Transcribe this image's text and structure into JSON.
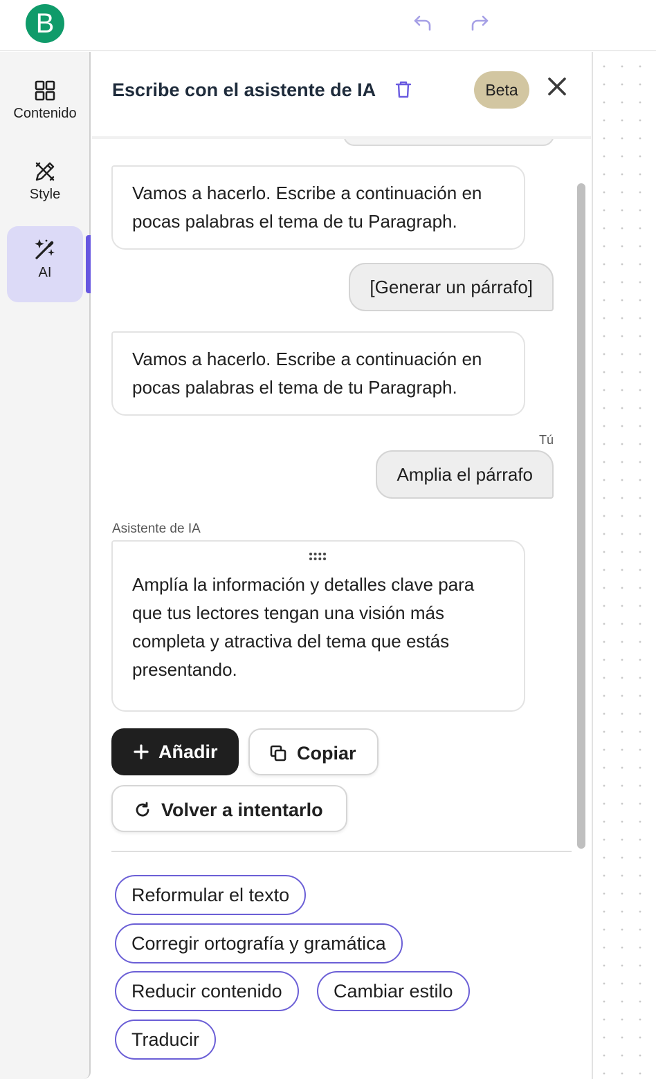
{
  "topbar": {
    "logo_letter": "B",
    "undo_icon": "undo-arrow-icon",
    "redo_icon": "redo-arrow-icon"
  },
  "sidebar": {
    "items": [
      {
        "label": "Contenido",
        "icon": "grid-icon",
        "active": false
      },
      {
        "label": "Style",
        "icon": "pen-ruler-icon",
        "active": false
      },
      {
        "label": "AI",
        "icon": "magic-wand-icon",
        "active": true
      }
    ],
    "accent_color": "#6656e0"
  },
  "panel": {
    "title": "Escribe con el asistente de IA",
    "badge": "Beta",
    "badge_color": "#d2c6a1"
  },
  "chat": {
    "messages": [
      {
        "role": "assistant",
        "text": "Vamos a hacerlo. Escribe a continuación en pocas palabras el tema de tu Paragraph."
      },
      {
        "role": "user",
        "text": "[Generar un párrafo]"
      },
      {
        "role": "assistant",
        "text": "Vamos a hacerlo. Escribe a continuación en pocas palabras el tema de tu Paragraph."
      },
      {
        "role": "user",
        "sender": "Tú",
        "text": "Amplia el párrafo"
      },
      {
        "role": "assistant",
        "sender": "Asistente de IA",
        "text": "Amplía la información y detalles clave para que tus lectores tengan una visión más completa y atractiva del tema que estás presentando."
      }
    ]
  },
  "actions": {
    "add": "Añadir",
    "copy": "Copiar",
    "retry": "Volver a intentarlo"
  },
  "suggestions": [
    "Reformular el texto",
    "Corregir ortografía y gramática",
    "Reducir contenido",
    "Cambiar estilo",
    "Traducir"
  ],
  "colors": {
    "brand_green": "#0f9b6a",
    "chip_border": "#6b5fd6",
    "primary_button": "#1f1f1f"
  }
}
